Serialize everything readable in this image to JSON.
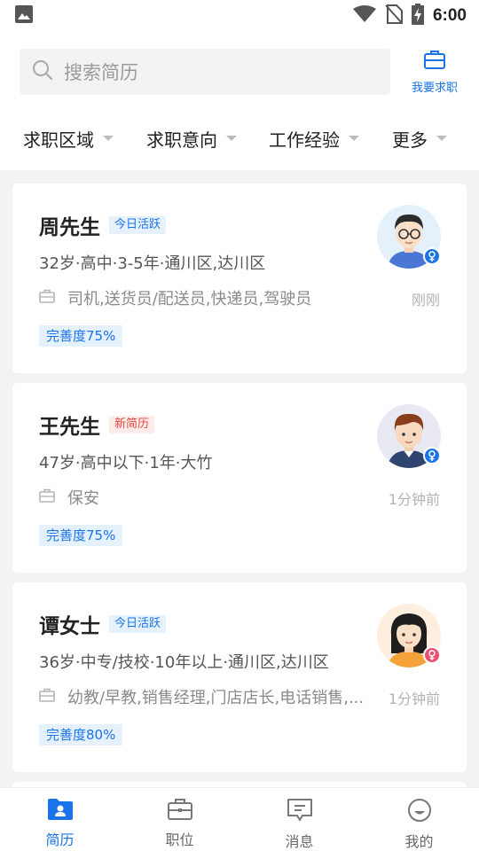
{
  "status_bar": {
    "time": "6:00",
    "icons": [
      "image-icon",
      "wifi-icon",
      "no-sim-icon",
      "battery-charging-icon"
    ]
  },
  "search": {
    "placeholder": "搜索简历"
  },
  "header": {
    "job_button_label": "我要求职"
  },
  "filters": [
    {
      "label": "求职区域"
    },
    {
      "label": "求职意向"
    },
    {
      "label": "工作经验"
    },
    {
      "label": "更多"
    }
  ],
  "cards": [
    {
      "name": "周先生",
      "tag": "今日活跃",
      "info": "32岁·高中·3-5年·通川区,达川区",
      "jobs": "司机,送货员/配送员,快递员,驾驶员",
      "time": "刚刚",
      "completion": "完善度75%",
      "gender": "male"
    },
    {
      "name": "王先生",
      "tag": "新简历",
      "info": "47岁·高中以下·1年·大竹",
      "jobs": "保安",
      "time": "1分钟前",
      "completion": "完善度75%",
      "gender": "male"
    },
    {
      "name": "谭女士",
      "tag": "今日活跃",
      "info": "36岁·中专/技校·10年以上·通川区,达川区",
      "jobs": "幼教/早教,销售经理,门店店长,电话销售,...",
      "time": "1分钟前",
      "completion": "完善度80%",
      "gender": "female"
    }
  ],
  "bottom_nav": [
    {
      "label": "简历",
      "icon": "resume-icon",
      "active": true
    },
    {
      "label": "职位",
      "icon": "briefcase-icon",
      "active": false
    },
    {
      "label": "消息",
      "icon": "message-icon",
      "active": false
    },
    {
      "label": "我的",
      "icon": "profile-icon",
      "active": false
    }
  ],
  "colors": {
    "accent": "#1a73e8",
    "new_tag": "#e04a3c",
    "male_badge": "#1a73e8",
    "female_badge": "#ef4f6f"
  }
}
